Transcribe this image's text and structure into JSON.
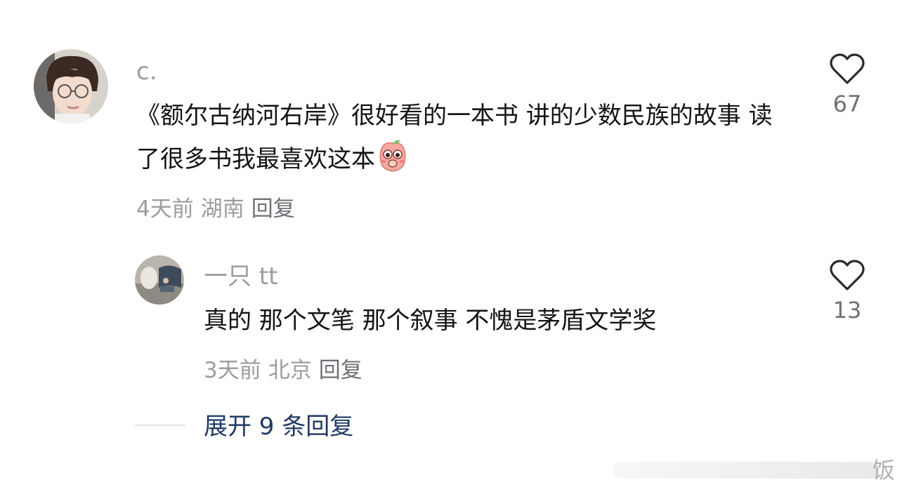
{
  "comments": [
    {
      "username": "c.",
      "text": "《额尔古纳河右岸》很好看的一本书 讲的少数民族的故事  读了很多书我最喜欢这本",
      "emoji": "blushing-peach-emoji",
      "time": "4天前",
      "location": "湖南",
      "reply_label": "回复",
      "likes": "67"
    },
    {
      "username": "一只 tt",
      "text": "真的 那个文笔 那个叙事 不愧是茅盾文学奖",
      "time": "3天前",
      "location": "北京",
      "reply_label": "回复",
      "likes": "13"
    }
  ],
  "expand_replies": "展开 9 条回复",
  "watermark": "饭",
  "colors": {
    "text": "#141414",
    "muted": "#9b9ca0",
    "link": "#1f3a64"
  }
}
